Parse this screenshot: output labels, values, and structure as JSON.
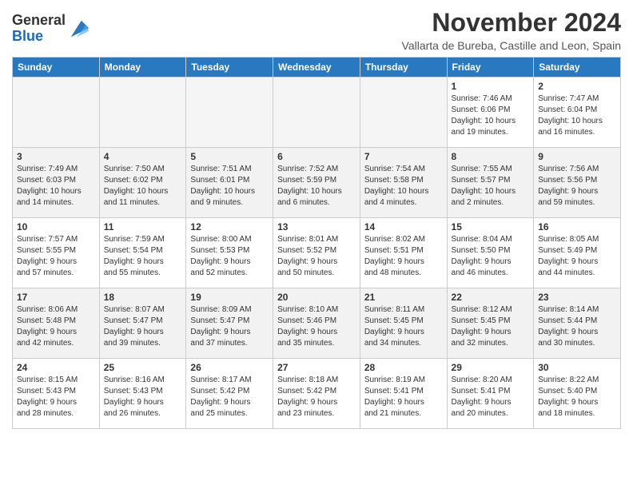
{
  "header": {
    "logo_general": "General",
    "logo_blue": "Blue",
    "month_title": "November 2024",
    "subtitle": "Vallarta de Bureba, Castille and Leon, Spain"
  },
  "weekdays": [
    "Sunday",
    "Monday",
    "Tuesday",
    "Wednesday",
    "Thursday",
    "Friday",
    "Saturday"
  ],
  "weeks": [
    [
      {
        "day": "",
        "info": ""
      },
      {
        "day": "",
        "info": ""
      },
      {
        "day": "",
        "info": ""
      },
      {
        "day": "",
        "info": ""
      },
      {
        "day": "",
        "info": ""
      },
      {
        "day": "1",
        "info": "Sunrise: 7:46 AM\nSunset: 6:06 PM\nDaylight: 10 hours\nand 19 minutes."
      },
      {
        "day": "2",
        "info": "Sunrise: 7:47 AM\nSunset: 6:04 PM\nDaylight: 10 hours\nand 16 minutes."
      }
    ],
    [
      {
        "day": "3",
        "info": "Sunrise: 7:49 AM\nSunset: 6:03 PM\nDaylight: 10 hours\nand 14 minutes."
      },
      {
        "day": "4",
        "info": "Sunrise: 7:50 AM\nSunset: 6:02 PM\nDaylight: 10 hours\nand 11 minutes."
      },
      {
        "day": "5",
        "info": "Sunrise: 7:51 AM\nSunset: 6:01 PM\nDaylight: 10 hours\nand 9 minutes."
      },
      {
        "day": "6",
        "info": "Sunrise: 7:52 AM\nSunset: 5:59 PM\nDaylight: 10 hours\nand 6 minutes."
      },
      {
        "day": "7",
        "info": "Sunrise: 7:54 AM\nSunset: 5:58 PM\nDaylight: 10 hours\nand 4 minutes."
      },
      {
        "day": "8",
        "info": "Sunrise: 7:55 AM\nSunset: 5:57 PM\nDaylight: 10 hours\nand 2 minutes."
      },
      {
        "day": "9",
        "info": "Sunrise: 7:56 AM\nSunset: 5:56 PM\nDaylight: 9 hours\nand 59 minutes."
      }
    ],
    [
      {
        "day": "10",
        "info": "Sunrise: 7:57 AM\nSunset: 5:55 PM\nDaylight: 9 hours\nand 57 minutes."
      },
      {
        "day": "11",
        "info": "Sunrise: 7:59 AM\nSunset: 5:54 PM\nDaylight: 9 hours\nand 55 minutes."
      },
      {
        "day": "12",
        "info": "Sunrise: 8:00 AM\nSunset: 5:53 PM\nDaylight: 9 hours\nand 52 minutes."
      },
      {
        "day": "13",
        "info": "Sunrise: 8:01 AM\nSunset: 5:52 PM\nDaylight: 9 hours\nand 50 minutes."
      },
      {
        "day": "14",
        "info": "Sunrise: 8:02 AM\nSunset: 5:51 PM\nDaylight: 9 hours\nand 48 minutes."
      },
      {
        "day": "15",
        "info": "Sunrise: 8:04 AM\nSunset: 5:50 PM\nDaylight: 9 hours\nand 46 minutes."
      },
      {
        "day": "16",
        "info": "Sunrise: 8:05 AM\nSunset: 5:49 PM\nDaylight: 9 hours\nand 44 minutes."
      }
    ],
    [
      {
        "day": "17",
        "info": "Sunrise: 8:06 AM\nSunset: 5:48 PM\nDaylight: 9 hours\nand 42 minutes."
      },
      {
        "day": "18",
        "info": "Sunrise: 8:07 AM\nSunset: 5:47 PM\nDaylight: 9 hours\nand 39 minutes."
      },
      {
        "day": "19",
        "info": "Sunrise: 8:09 AM\nSunset: 5:47 PM\nDaylight: 9 hours\nand 37 minutes."
      },
      {
        "day": "20",
        "info": "Sunrise: 8:10 AM\nSunset: 5:46 PM\nDaylight: 9 hours\nand 35 minutes."
      },
      {
        "day": "21",
        "info": "Sunrise: 8:11 AM\nSunset: 5:45 PM\nDaylight: 9 hours\nand 34 minutes."
      },
      {
        "day": "22",
        "info": "Sunrise: 8:12 AM\nSunset: 5:45 PM\nDaylight: 9 hours\nand 32 minutes."
      },
      {
        "day": "23",
        "info": "Sunrise: 8:14 AM\nSunset: 5:44 PM\nDaylight: 9 hours\nand 30 minutes."
      }
    ],
    [
      {
        "day": "24",
        "info": "Sunrise: 8:15 AM\nSunset: 5:43 PM\nDaylight: 9 hours\nand 28 minutes."
      },
      {
        "day": "25",
        "info": "Sunrise: 8:16 AM\nSunset: 5:43 PM\nDaylight: 9 hours\nand 26 minutes."
      },
      {
        "day": "26",
        "info": "Sunrise: 8:17 AM\nSunset: 5:42 PM\nDaylight: 9 hours\nand 25 minutes."
      },
      {
        "day": "27",
        "info": "Sunrise: 8:18 AM\nSunset: 5:42 PM\nDaylight: 9 hours\nand 23 minutes."
      },
      {
        "day": "28",
        "info": "Sunrise: 8:19 AM\nSunset: 5:41 PM\nDaylight: 9 hours\nand 21 minutes."
      },
      {
        "day": "29",
        "info": "Sunrise: 8:20 AM\nSunset: 5:41 PM\nDaylight: 9 hours\nand 20 minutes."
      },
      {
        "day": "30",
        "info": "Sunrise: 8:22 AM\nSunset: 5:40 PM\nDaylight: 9 hours\nand 18 minutes."
      }
    ]
  ]
}
